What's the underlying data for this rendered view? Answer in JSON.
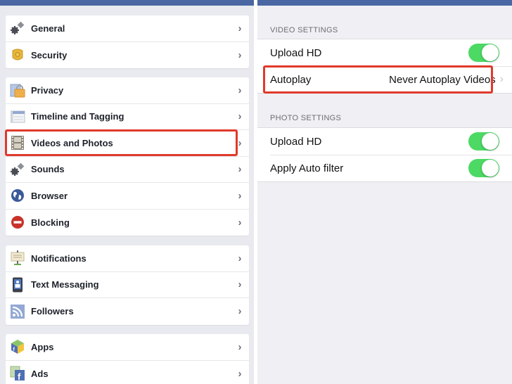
{
  "left": {
    "groups": [
      {
        "items": [
          {
            "label": "General",
            "icon": "gears-icon"
          },
          {
            "label": "Security",
            "icon": "badge-icon"
          }
        ]
      },
      {
        "items": [
          {
            "label": "Privacy",
            "icon": "lock-icon"
          },
          {
            "label": "Timeline and Tagging",
            "icon": "timeline-icon"
          },
          {
            "label": "Videos and Photos",
            "icon": "film-icon",
            "highlighted": true
          },
          {
            "label": "Sounds",
            "icon": "gears-icon"
          },
          {
            "label": "Browser",
            "icon": "globe-icon"
          },
          {
            "label": "Blocking",
            "icon": "blocked-icon"
          }
        ]
      },
      {
        "items": [
          {
            "label": "Notifications",
            "icon": "notice-board-icon"
          },
          {
            "label": "Text Messaging",
            "icon": "phone-icon"
          },
          {
            "label": "Followers",
            "icon": "rss-icon"
          }
        ]
      },
      {
        "items": [
          {
            "label": "Apps",
            "icon": "cube-icon"
          },
          {
            "label": "Ads",
            "icon": "facebook-ads-icon"
          }
        ]
      }
    ],
    "chevron": "›"
  },
  "right": {
    "video_settings": {
      "header": "VIDEO SETTINGS",
      "upload_hd": {
        "label": "Upload HD",
        "on": true
      },
      "autoplay": {
        "label": "Autoplay",
        "value": "Never Autoplay Videos"
      }
    },
    "photo_settings": {
      "header": "PHOTO SETTINGS",
      "upload_hd": {
        "label": "Upload HD",
        "on": true
      },
      "auto_filter": {
        "label": "Apply Auto filter",
        "on": true
      }
    },
    "chevron": "›"
  },
  "colors": {
    "brand_blue": "#4a67a3",
    "toggle_on": "#4cd964",
    "highlight_red": "#e0392b"
  }
}
